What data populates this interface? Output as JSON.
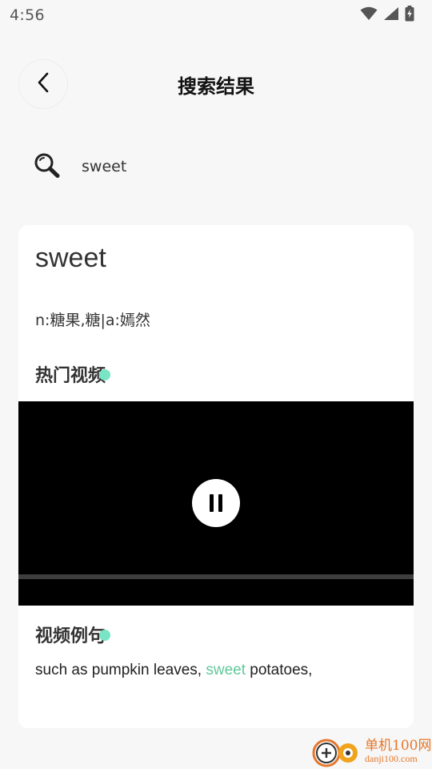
{
  "status_bar": {
    "time": "4:56",
    "icons": [
      "wifi-icon",
      "cell-signal-icon",
      "battery-charging-icon"
    ]
  },
  "header": {
    "back_icon": "chevron-left-icon",
    "title": "搜索结果"
  },
  "search": {
    "icon": "search-icon",
    "query": "sweet"
  },
  "result": {
    "word": "sweet",
    "definition": "n:糖果,糖|a:嫣然",
    "hot_videos_title": "热门视频",
    "video": {
      "state": "paused-control-visible",
      "control_icon": "pause-icon"
    },
    "examples_title": "视频例句",
    "example": {
      "before": "such as pumpkin leaves, ",
      "highlight": "sweet",
      "after": " potatoes,"
    }
  },
  "watermark": {
    "name": "单机100网",
    "url": "danji100.com"
  },
  "colors": {
    "accent": "#5fc99a",
    "title_dot": "#79e5c4",
    "background": "#f7f7f7",
    "card": "#ffffff",
    "watermark": "#e5772b"
  }
}
